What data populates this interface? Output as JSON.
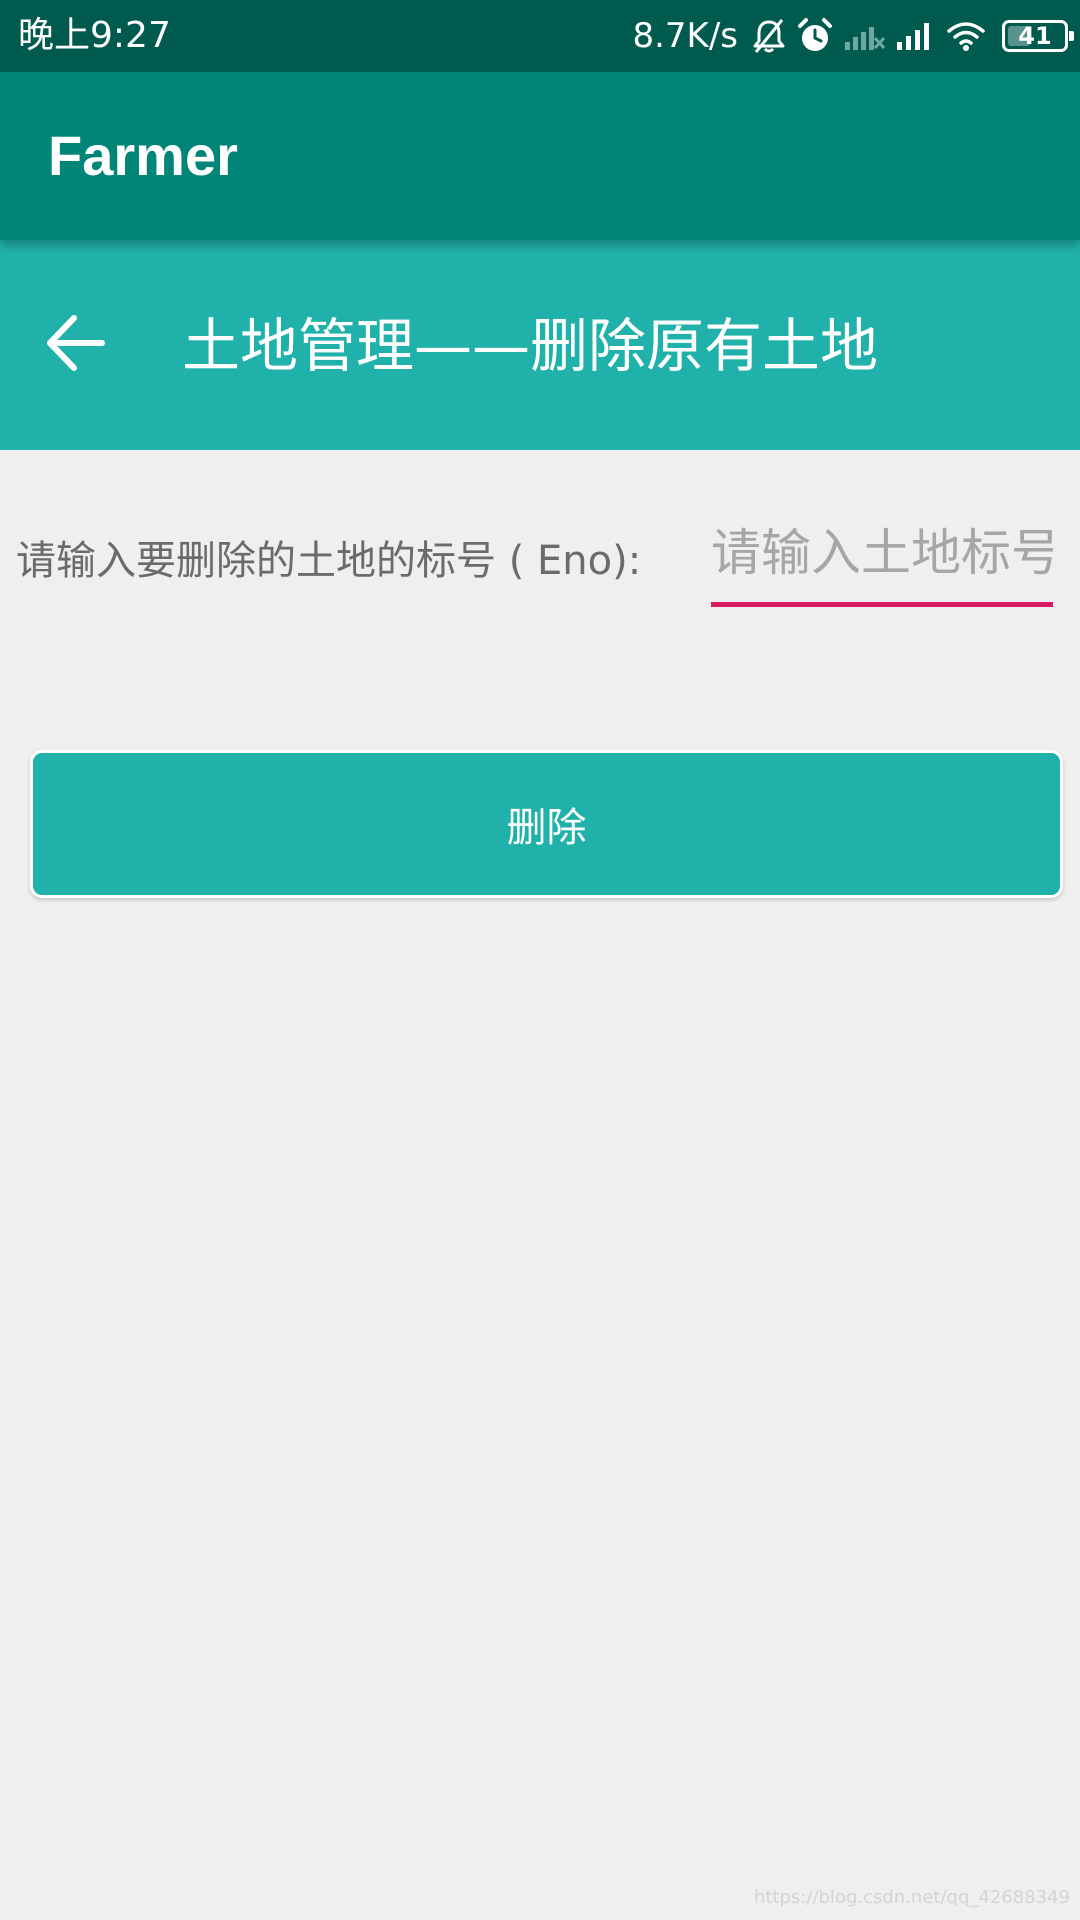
{
  "status_bar": {
    "time": "晚上9:27",
    "net_speed": "8.7K/s",
    "battery_level": "41",
    "battery_fraction": 0.41,
    "icons": [
      "bell-off-icon",
      "alarm-icon",
      "signal-off-icon",
      "signal-icon",
      "wifi-icon",
      "battery-icon"
    ]
  },
  "app_bar": {
    "title": "Farmer"
  },
  "toolbar": {
    "back_icon": "arrow-left-icon",
    "title": "土地管理——删除原有土地"
  },
  "form": {
    "label": "请输入要删除的土地的标号 ( Eno):",
    "input_value": "",
    "input_placeholder": "请输入土地标号"
  },
  "actions": {
    "delete_label": "删除"
  },
  "watermark": "https://blog.csdn.net/qq_42688349",
  "colors": {
    "status_bar": "#005a4e",
    "app_bar": "#018577",
    "toolbar": "#20b2aa",
    "button": "#20b2aa",
    "input_underline": "#d81b60",
    "background": "#efeff0"
  }
}
